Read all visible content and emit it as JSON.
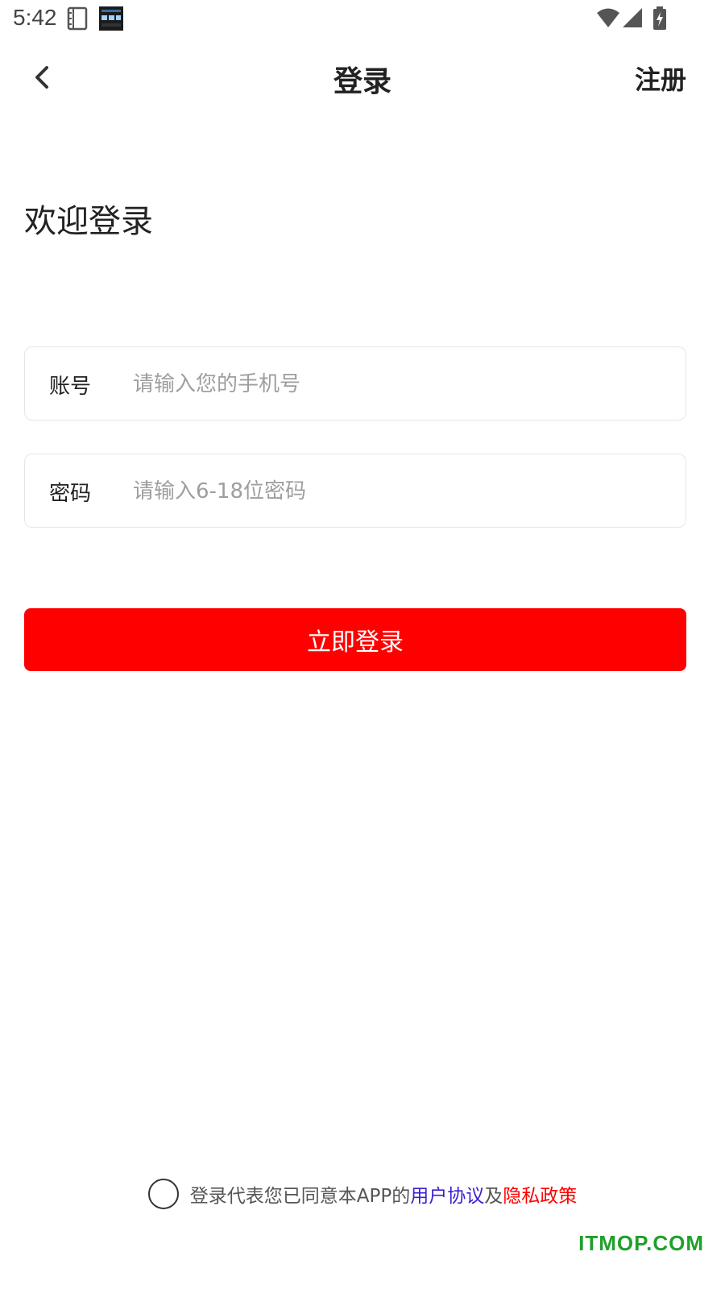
{
  "status_bar": {
    "time": "5:42",
    "icons": [
      "notes-icon",
      "clock-widget-icon",
      "wifi-icon",
      "signal-icon",
      "battery-charging-icon"
    ]
  },
  "nav": {
    "title": "登录",
    "register_label": "注册",
    "back_icon": "chevron-left-icon"
  },
  "welcome_text": "欢迎登录",
  "form": {
    "account": {
      "label": "账号",
      "placeholder": "请输入您的手机号",
      "value": ""
    },
    "password": {
      "label": "密码",
      "placeholder": "请输入6-18位密码",
      "value": ""
    }
  },
  "login_button_label": "立即登录",
  "agreement": {
    "prefix": "登录代表您已同意本APP的",
    "terms": "用户协议",
    "joiner": "及",
    "privacy": "隐私政策",
    "checked": false
  },
  "watermark": "ITMOP.COM",
  "colors": {
    "primary": "#ff0000",
    "terms_link": "#3a1fd1",
    "privacy_link": "#ff0000",
    "watermark": "#1fa02a"
  }
}
